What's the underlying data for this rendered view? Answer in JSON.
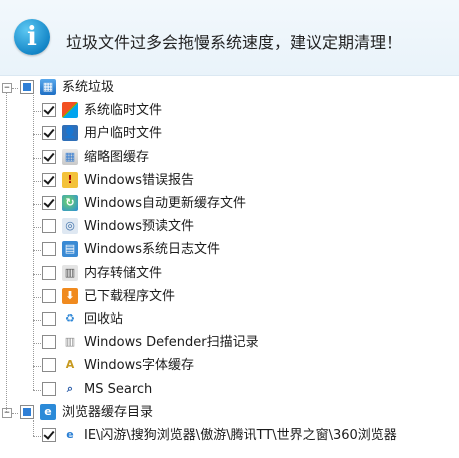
{
  "banner": {
    "icon": "info-icon",
    "icon_glyph": "i",
    "message": "垃圾文件过多会拖慢系统速度，建议定期清理！"
  },
  "tree": {
    "expander_glyph": "−",
    "groups": [
      {
        "label": "系统垃圾",
        "state": "partial",
        "icon": "windows-window-icon",
        "items": [
          {
            "label": "系统临时文件",
            "checked": true,
            "icon": "windows-flag-icon"
          },
          {
            "label": "用户临时文件",
            "checked": true,
            "icon": "users-icon"
          },
          {
            "label": "缩略图缓存",
            "checked": true,
            "icon": "thumbnail-icon"
          },
          {
            "label": "Windows错误报告",
            "checked": true,
            "icon": "error-report-icon"
          },
          {
            "label": "Windows自动更新缓存文件",
            "checked": true,
            "icon": "windows-update-icon"
          },
          {
            "label": "Windows预读文件",
            "checked": false,
            "icon": "prefetch-icon"
          },
          {
            "label": "Windows系统日志文件",
            "checked": false,
            "icon": "system-log-icon"
          },
          {
            "label": "内存转储文件",
            "checked": false,
            "icon": "memory-dump-icon"
          },
          {
            "label": "已下载程序文件",
            "checked": false,
            "icon": "download-icon"
          },
          {
            "label": "回收站",
            "checked": false,
            "icon": "recycle-bin-icon"
          },
          {
            "label": "Windows Defender扫描记录",
            "checked": false,
            "icon": "defender-icon"
          },
          {
            "label": "Windows字体缓存",
            "checked": false,
            "icon": "font-cache-icon"
          },
          {
            "label": "MS Search",
            "checked": false,
            "icon": "search-icon"
          }
        ]
      },
      {
        "label": "浏览器缓存目录",
        "state": "partial",
        "icon": "browser-icon",
        "items": [
          {
            "label": "IE\\闪游\\搜狗浏览器\\傲游\\腾讯TT\\世界之窗\\360浏览器",
            "checked": true,
            "icon": "ie-icon"
          }
        ]
      }
    ]
  },
  "colors": {
    "banner_bg": "#eaf4fb",
    "info_blue": "#1587c8",
    "partial_blue": "#2f7fd6"
  }
}
